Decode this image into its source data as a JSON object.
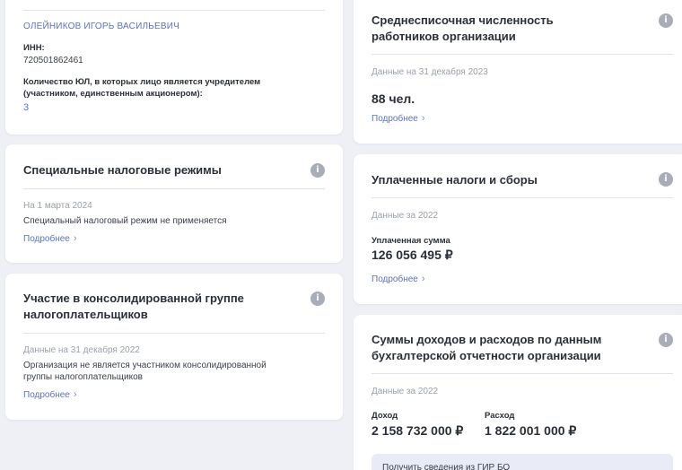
{
  "founder": {
    "name": "ОЛЕЙНИКОВ ИГОРЬ ВАСИЛЬЕВИЧ",
    "inn_label": "ИНН:",
    "inn_value": "720501862461",
    "count_label": "Количество ЮЛ, в которых лицо является учредителем (участником, единственным акционером):",
    "count_value": "3"
  },
  "tax_regimes": {
    "title": "Специальные налоговые режимы",
    "date": "На 1 марта 2024",
    "text": "Специальный налоговый режим не применяется",
    "more": "Подробнее",
    "more_icon": "chevron-right-icon",
    "info_icon": "info-icon"
  },
  "consolidated": {
    "title": "Участие в консолидированной группе налогоплательщиков",
    "date": "Данные на 31 декабря 2022",
    "text": "Организация не является участником консолидированной группы налогоплательщиков",
    "more": "Подробнее"
  },
  "employees": {
    "title": "Среднесписочная численность работников организации",
    "date": "Данные на 31 декабря 2023",
    "value": "88 чел.",
    "more": "Подробнее"
  },
  "taxes_paid": {
    "title": "Уплаченные налоги и сборы",
    "date": "Данные за 2022",
    "sum_label": "Уплаченная сумма",
    "sum_value": "126 056 495 ₽",
    "more": "Подробнее"
  },
  "income": {
    "title": "Суммы доходов и расходов по данным бухгалтерской отчетности организации",
    "date": "Данные за 2022",
    "income_label": "Доход",
    "income_value": "2 158 732 000 ₽",
    "expense_label": "Расход",
    "expense_value": "1 822 001 000 ₽",
    "notice": "Получить сведения из ГИР БО"
  },
  "colors": {
    "background": "#eef0f6",
    "card": "#ffffff",
    "link": "#5b72c4",
    "muted": "#9aa0ad",
    "info_icon": "#a9adb8"
  }
}
